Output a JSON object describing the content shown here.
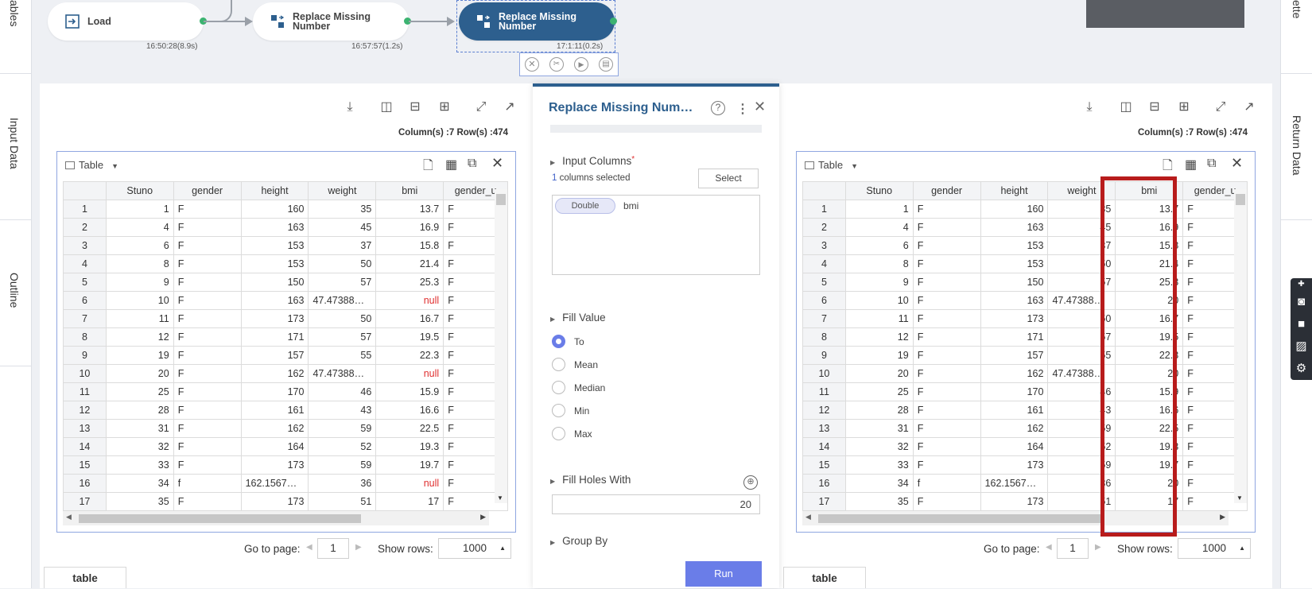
{
  "left_rail": {
    "items": [
      "ables",
      "Input Data",
      "Outline"
    ]
  },
  "right_rail": {
    "items": [
      "ette",
      "Return Data"
    ]
  },
  "workflow": {
    "nodes": [
      {
        "label": "Load",
        "time": "16:50:28(8.9s)"
      },
      {
        "label": "Replace Missing Number",
        "time": "16:57:57(1.2s)"
      },
      {
        "label": "Replace Missing Number",
        "time": "17:1:11(0.2s)"
      }
    ],
    "colors": {
      "active_node": "#2d5f8e",
      "port": "#3cb371"
    }
  },
  "left_panel": {
    "counts": "Column(s) :7   Row(s) :474",
    "table_title": "Table",
    "columns": [
      "",
      "Stuno",
      "gender",
      "height",
      "weight",
      "bmi",
      "gender_u"
    ],
    "rows": [
      [
        "1",
        "1",
        "F",
        "160",
        "35",
        "13.7",
        "F"
      ],
      [
        "2",
        "4",
        "F",
        "163",
        "45",
        "16.9",
        "F"
      ],
      [
        "3",
        "6",
        "F",
        "153",
        "37",
        "15.8",
        "F"
      ],
      [
        "4",
        "8",
        "F",
        "153",
        "50",
        "21.4",
        "F"
      ],
      [
        "5",
        "9",
        "F",
        "150",
        "57",
        "25.3",
        "F"
      ],
      [
        "6",
        "10",
        "F",
        "163",
        "47.47388…",
        "null",
        "F"
      ],
      [
        "7",
        "11",
        "F",
        "173",
        "50",
        "16.7",
        "F"
      ],
      [
        "8",
        "12",
        "F",
        "171",
        "57",
        "19.5",
        "F"
      ],
      [
        "9",
        "19",
        "F",
        "157",
        "55",
        "22.3",
        "F"
      ],
      [
        "10",
        "20",
        "F",
        "162",
        "47.47388…",
        "null",
        "F"
      ],
      [
        "11",
        "25",
        "F",
        "170",
        "46",
        "15.9",
        "F"
      ],
      [
        "12",
        "28",
        "F",
        "161",
        "43",
        "16.6",
        "F"
      ],
      [
        "13",
        "31",
        "F",
        "162",
        "59",
        "22.5",
        "F"
      ],
      [
        "14",
        "32",
        "F",
        "164",
        "52",
        "19.3",
        "F"
      ],
      [
        "15",
        "33",
        "F",
        "173",
        "59",
        "19.7",
        "F"
      ],
      [
        "16",
        "34",
        "f",
        "162.1567…",
        "36",
        "null",
        "F"
      ],
      [
        "17",
        "35",
        "F",
        "173",
        "51",
        "17",
        "F"
      ]
    ],
    "pager": {
      "go_to_label": "Go to page:",
      "page": "1",
      "show_rows_label": "Show rows:",
      "rows": "1000"
    },
    "tab": "table"
  },
  "right_panel": {
    "counts": "Column(s) :7   Row(s) :474",
    "table_title": "Table",
    "columns": [
      "",
      "Stuno",
      "gender",
      "height",
      "weight",
      "bmi",
      "gender_u"
    ],
    "rows": [
      [
        "1",
        "1",
        "F",
        "160",
        "35",
        "13.7",
        "F"
      ],
      [
        "2",
        "4",
        "F",
        "163",
        "45",
        "16.9",
        "F"
      ],
      [
        "3",
        "6",
        "F",
        "153",
        "37",
        "15.8",
        "F"
      ],
      [
        "4",
        "8",
        "F",
        "153",
        "50",
        "21.4",
        "F"
      ],
      [
        "5",
        "9",
        "F",
        "150",
        "57",
        "25.3",
        "F"
      ],
      [
        "6",
        "10",
        "F",
        "163",
        "47.47388…",
        "20",
        "F"
      ],
      [
        "7",
        "11",
        "F",
        "173",
        "50",
        "16.7",
        "F"
      ],
      [
        "8",
        "12",
        "F",
        "171",
        "57",
        "19.5",
        "F"
      ],
      [
        "9",
        "19",
        "F",
        "157",
        "55",
        "22.3",
        "F"
      ],
      [
        "10",
        "20",
        "F",
        "162",
        "47.47388…",
        "20",
        "F"
      ],
      [
        "11",
        "25",
        "F",
        "170",
        "46",
        "15.9",
        "F"
      ],
      [
        "12",
        "28",
        "F",
        "161",
        "43",
        "16.6",
        "F"
      ],
      [
        "13",
        "31",
        "F",
        "162",
        "59",
        "22.5",
        "F"
      ],
      [
        "14",
        "32",
        "F",
        "164",
        "52",
        "19.3",
        "F"
      ],
      [
        "15",
        "33",
        "F",
        "173",
        "59",
        "19.7",
        "F"
      ],
      [
        "16",
        "34",
        "f",
        "162.1567…",
        "36",
        "20",
        "F"
      ],
      [
        "17",
        "35",
        "F",
        "173",
        "51",
        "17",
        "F"
      ]
    ],
    "pager": {
      "go_to_label": "Go to page:",
      "page": "1",
      "show_rows_label": "Show rows:",
      "rows": "1000"
    },
    "tab": "table",
    "highlight_color": "#b81c1c"
  },
  "dialog": {
    "title": "Replace Missing Num…",
    "input_columns_label": "Input Columns",
    "required_mark": "*",
    "selected_count": "1",
    "selected_text": "columns selected",
    "select_button": "Select",
    "chip_type": "Double",
    "chip_column": "bmi",
    "fill_value_label": "Fill Value",
    "options": [
      "To",
      "Mean",
      "Median",
      "Min",
      "Max"
    ],
    "selected_option": "To",
    "fill_holes_label": "Fill Holes With",
    "fill_holes_value": "20",
    "group_by_label": "Group By",
    "run_button": "Run",
    "accent": "#6a7de8"
  }
}
